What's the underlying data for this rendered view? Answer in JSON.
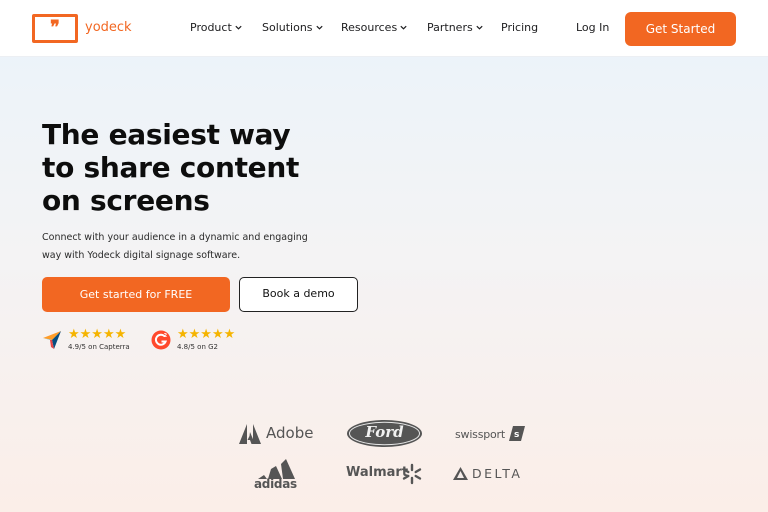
{
  "nav": {
    "logo_mark": "❞",
    "logo_text": "yodeck",
    "items": [
      {
        "label": "Product",
        "has_dropdown": true
      },
      {
        "label": "Solutions",
        "has_dropdown": true
      },
      {
        "label": "Resources",
        "has_dropdown": true
      },
      {
        "label": "Partners",
        "has_dropdown": true
      },
      {
        "label": "Pricing",
        "has_dropdown": false
      }
    ],
    "login": "Log In",
    "cta": "Get Started"
  },
  "hero": {
    "title_lines": [
      "The easiest way",
      "to share content",
      "on screens"
    ],
    "subtitle_lines": [
      "Connect with your audience in a dynamic and engaging",
      "way with Yodeck digital signage software."
    ],
    "primary_button": "Get started for FREE",
    "secondary_button": "Book a demo"
  },
  "ratings": [
    {
      "source_icon": "capterra-icon",
      "stars": "★★★★★",
      "text": "4.9/5 on Capterra",
      "value": 4.9
    },
    {
      "source_icon": "g2-icon",
      "stars": "★★★★★",
      "text": "4.8/5 on G2",
      "value": 4.8
    }
  ],
  "client_logos": {
    "adobe": "Adobe",
    "ford": "Ford",
    "swissport": "swissport",
    "adidas": "adidas",
    "walmart": "Walmart",
    "delta": "DELTA"
  },
  "colors": {
    "accent": "#f26722",
    "star": "#f5b400"
  }
}
